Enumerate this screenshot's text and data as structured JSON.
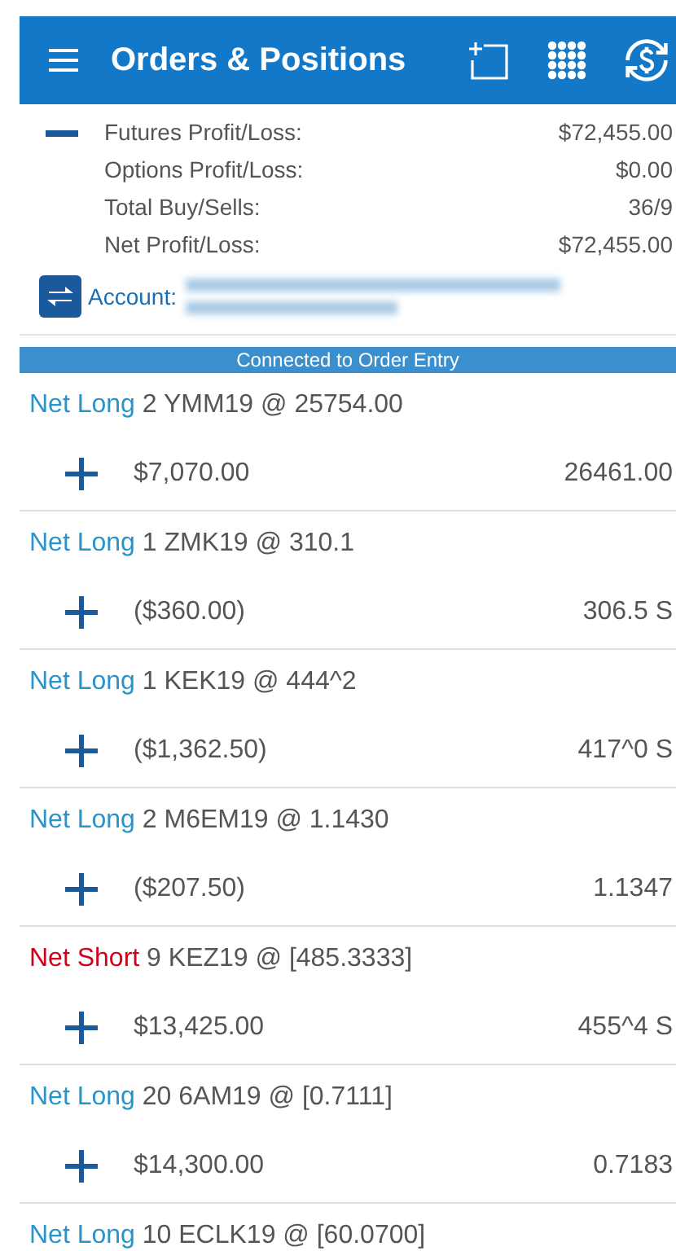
{
  "header": {
    "title": "Orders & Positions"
  },
  "summary": {
    "expanded": true,
    "rows": [
      {
        "label": "Futures Profit/Loss:",
        "value": "$72,455.00"
      },
      {
        "label": "Options Profit/Loss:",
        "value": "$0.00"
      },
      {
        "label": "Total Buy/Sells:",
        "value": "36/9"
      },
      {
        "label": "Net Profit/Loss:",
        "value": "$72,455.00"
      }
    ],
    "account_label": "Account:"
  },
  "status_banner": "Connected to Order Entry",
  "positions": [
    {
      "kind": "long",
      "side": "Net Long",
      "detail": "2 YMM19 @ 25754.00",
      "pnl": "$7,070.00",
      "price": "26461.00"
    },
    {
      "kind": "long",
      "side": "Net Long",
      "detail": "1 ZMK19 @ 310.1",
      "pnl": "($360.00)",
      "price": "306.5 S"
    },
    {
      "kind": "long",
      "side": "Net Long",
      "detail": "1 KEK19 @ 444^2",
      "pnl": "($1,362.50)",
      "price": "417^0 S"
    },
    {
      "kind": "long",
      "side": "Net Long",
      "detail": "2 M6EM19 @ 1.1430",
      "pnl": "($207.50)",
      "price": "1.1347"
    },
    {
      "kind": "short",
      "side": "Net Short",
      "detail": "9 KEZ19 @ [485.3333]",
      "pnl": "$13,425.00",
      "price": "455^4 S"
    },
    {
      "kind": "long",
      "side": "Net Long",
      "detail": "20 6AM19 @ [0.7111]",
      "pnl": "$14,300.00",
      "price": "0.7183"
    },
    {
      "kind": "long",
      "side": "Net Long",
      "detail": "10 ECLK19 @ [60.0700]"
    }
  ]
}
